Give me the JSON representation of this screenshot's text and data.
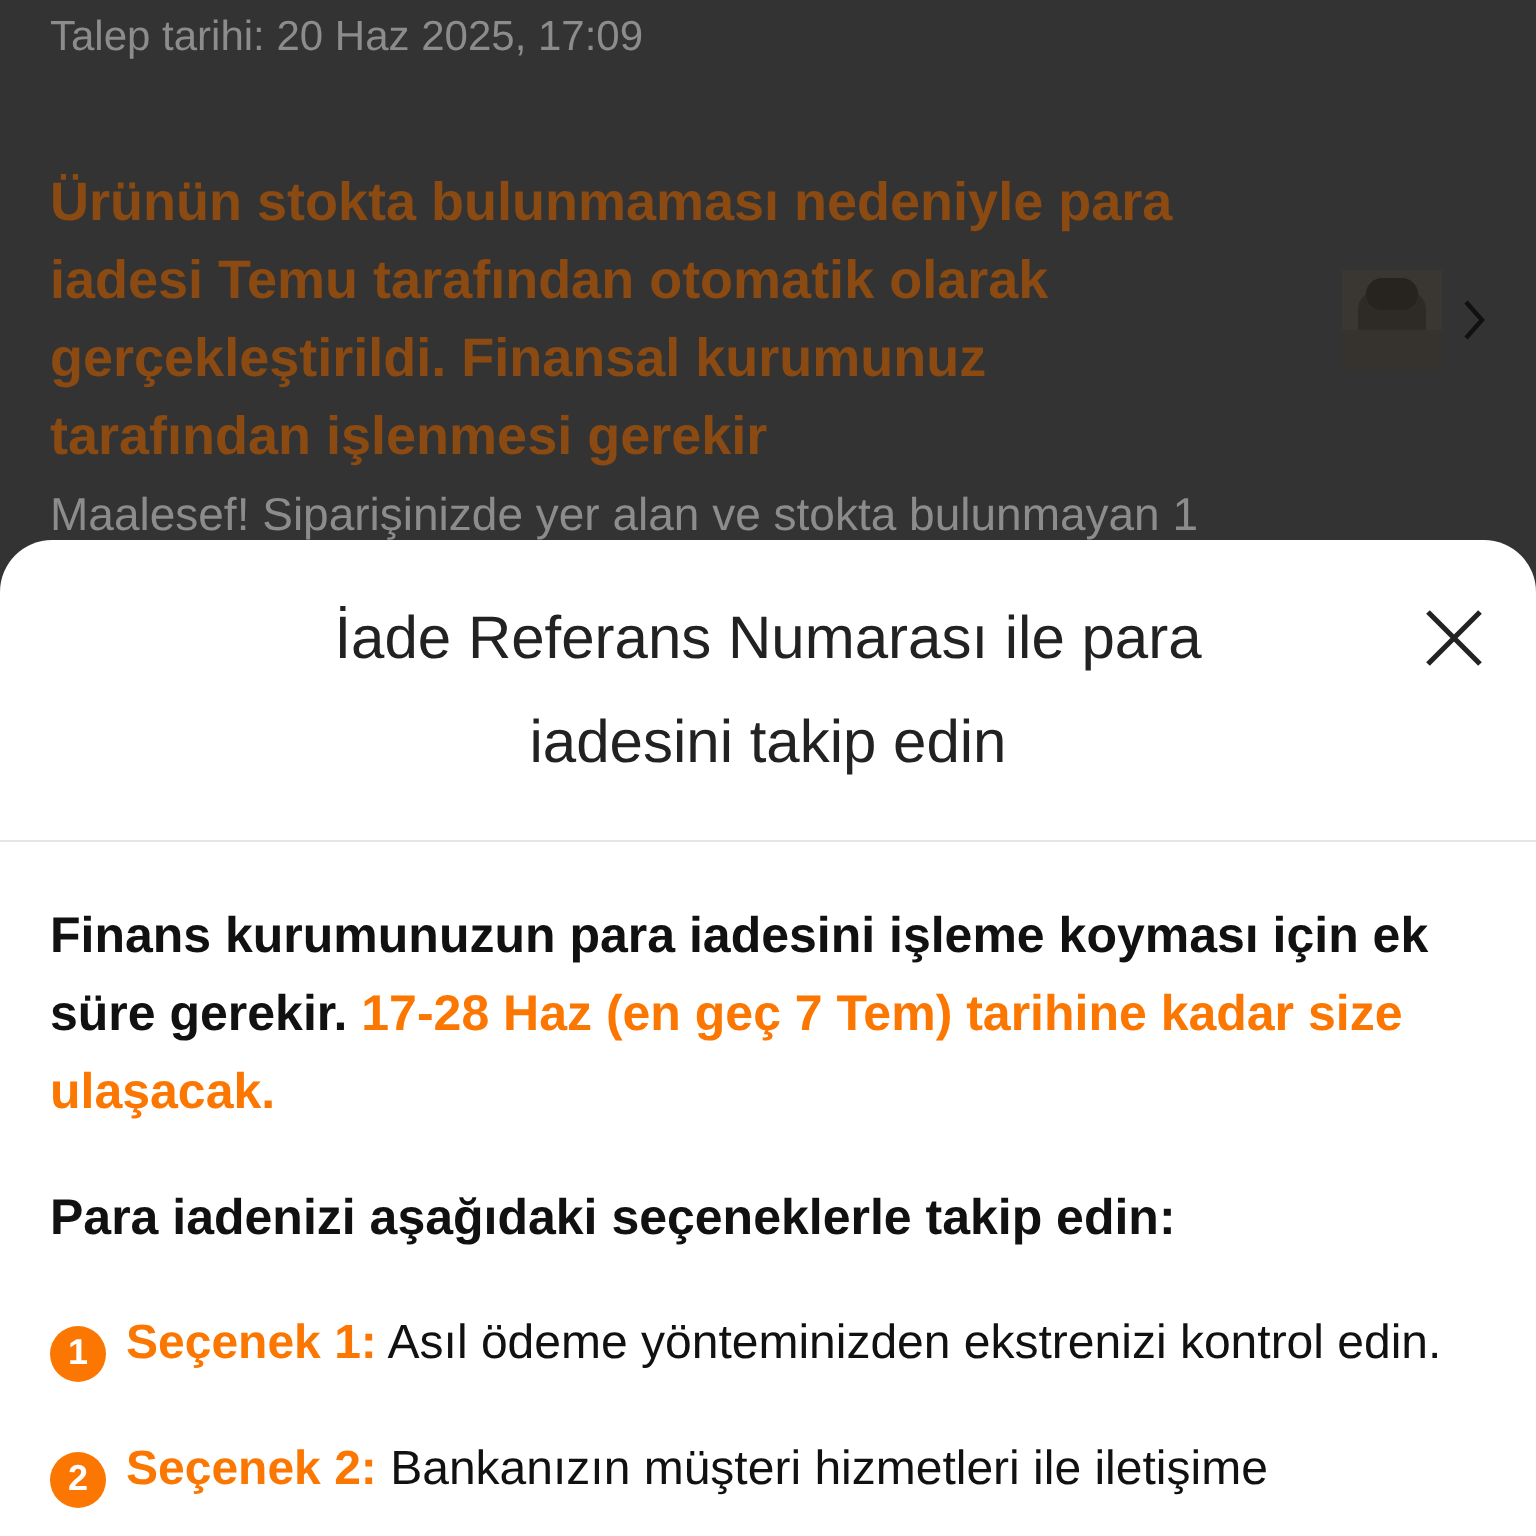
{
  "background": {
    "request_date": "Talep tarihi: 20 Haz 2025, 17:09",
    "title": "Ürünün stokta bulunmaması nedeniyle para iadesi Temu tarafından otomatik olarak gerçekleştirildi. Finansal kurumunuz tarafından işlenmesi gerekir",
    "description": "Maalesef! Siparişinizde yer alan ve stokta bulunmayan 1"
  },
  "sheet": {
    "title": "İade Referans Numarası ile para iadesini takip edin",
    "intro": "Finans kurumunuzun para iadesini işleme koyması için ek süre gerekir.",
    "intro_highlight": "17-28 Haz (en geç 7 Tem) tarihine kadar size ulaşacak.",
    "options_heading": "Para iadenizi aşağıdaki seçeneklerle takip edin:",
    "options": [
      {
        "number": "1",
        "label": "Seçenek 1:",
        "text": "Asıl ödeme yönteminizden ekstrenizi kontrol edin."
      },
      {
        "number": "2",
        "label": "Seçenek 2:",
        "text": "Bankanızın müşteri hizmetleri ile iletişime"
      }
    ]
  }
}
